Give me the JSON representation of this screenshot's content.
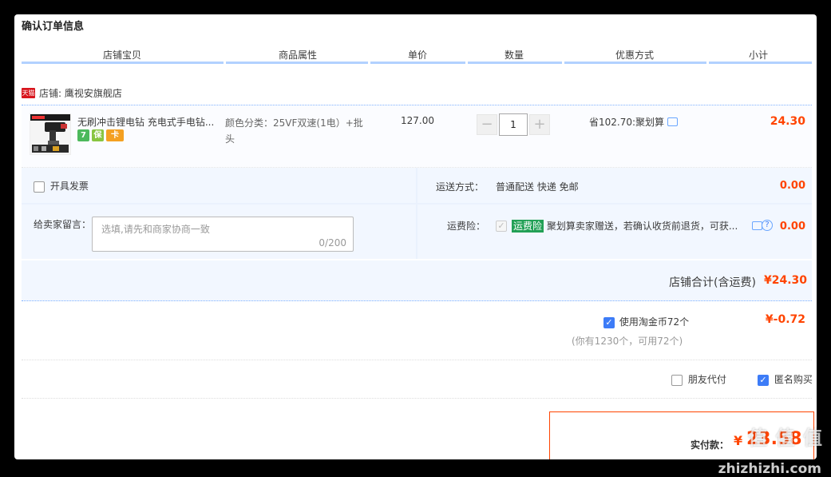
{
  "panel": {
    "title": "确认订单信息"
  },
  "columns": [
    "店铺宝贝",
    "商品属性",
    "单价",
    "数量",
    "优惠方式",
    "小计"
  ],
  "shop": {
    "badge": "天猫",
    "name": "店铺: 鹰视安旗舰店"
  },
  "item": {
    "title": "无刷冲击锂电钻 充电式手电钻...",
    "attribute": "颜色分类：25VF双速(1电）+批头",
    "unit_price": "127.00",
    "quantity": "1",
    "qty_minus": "−",
    "qty_plus": "+",
    "discount": "省102.70:聚划算",
    "subtotal": "24.30",
    "badges": [
      "7",
      "保",
      "卡"
    ]
  },
  "invoice": {
    "label": "开具发票"
  },
  "shipping": {
    "label": "运送方式：",
    "value": "普通配送 快递 免邮",
    "price": "0.00"
  },
  "message": {
    "label": "给卖家留言：",
    "placeholder": "选填,请先和商家协商一致",
    "counter": "0/200"
  },
  "insurance": {
    "label": "运费险：",
    "tag": "运费险",
    "text": "聚划算卖家赠送，若确认收货前退货，可获...",
    "price": "0.00",
    "help": "?"
  },
  "shop_total": {
    "label": "店铺合计(含运费)",
    "value": "¥24.30"
  },
  "coin": {
    "label": "使用淘金币72个",
    "note": "(你有1230个，可用72个)",
    "value": "¥-0.72"
  },
  "options": {
    "friend_pay": "朋友代付",
    "anonymous": "匿名购买"
  },
  "pay": {
    "label": "实付款：",
    "symbol": "¥",
    "value": "23.58"
  },
  "watermark": {
    "text": "值 值 值",
    "domain": "zhizhizhi.com"
  }
}
